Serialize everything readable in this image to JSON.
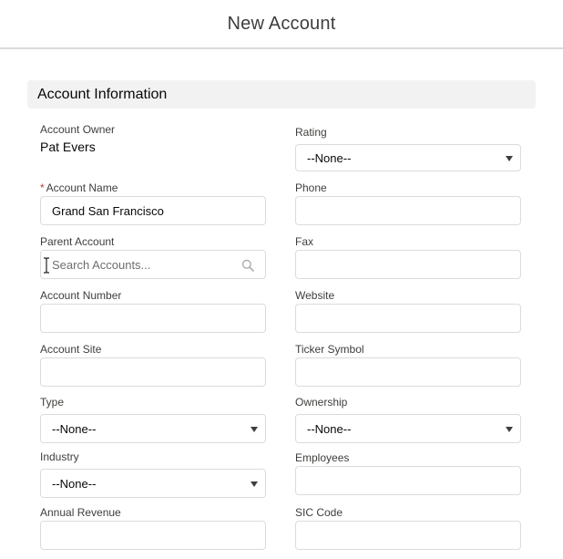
{
  "header": {
    "title": "New Account"
  },
  "section": {
    "title": "Account Information"
  },
  "left": {
    "account_owner": {
      "label": "Account Owner",
      "value": "Pat Evers"
    },
    "account_name": {
      "label": "Account Name",
      "required": "*",
      "value": "Grand San Francisco"
    },
    "parent_account": {
      "label": "Parent Account",
      "placeholder": "Search Accounts..."
    },
    "account_number": {
      "label": "Account Number",
      "value": ""
    },
    "account_site": {
      "label": "Account Site",
      "value": ""
    },
    "type": {
      "label": "Type",
      "value": "--None--"
    },
    "industry": {
      "label": "Industry",
      "value": "--None--"
    },
    "annual_revenue": {
      "label": "Annual Revenue",
      "value": ""
    }
  },
  "right": {
    "rating": {
      "label": "Rating",
      "value": "--None--"
    },
    "phone": {
      "label": "Phone",
      "value": ""
    },
    "fax": {
      "label": "Fax",
      "value": ""
    },
    "website": {
      "label": "Website",
      "value": ""
    },
    "ticker_symbol": {
      "label": "Ticker Symbol",
      "value": ""
    },
    "ownership": {
      "label": "Ownership",
      "value": "--None--"
    },
    "employees": {
      "label": "Employees",
      "value": ""
    },
    "sic_code": {
      "label": "SIC Code",
      "value": ""
    }
  },
  "icons": {
    "search": "search-icon",
    "caret": "chevron-down-icon",
    "text_cursor": "text-cursor-icon"
  },
  "colors": {
    "required": "#c23934",
    "section_bg": "#f3f2f2",
    "border": "#dddbda"
  }
}
